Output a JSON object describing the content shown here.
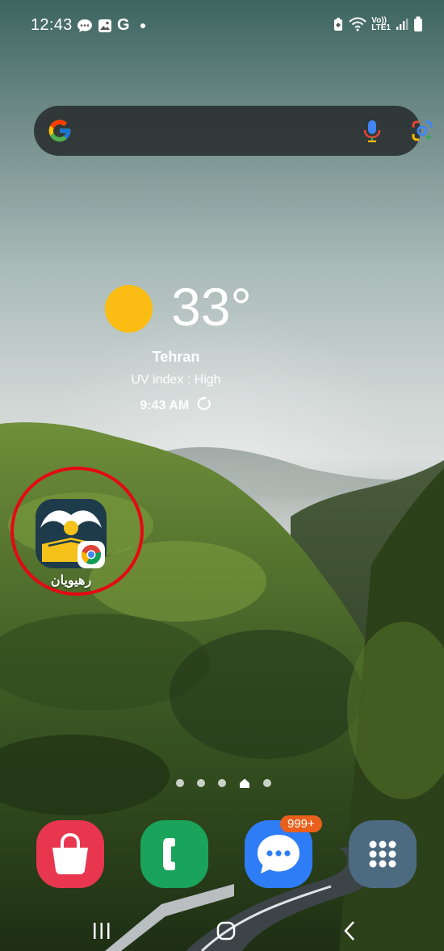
{
  "status_bar": {
    "time": "12:43",
    "notification_icons": [
      "message-icon",
      "gallery-icon",
      "google-icon",
      "dot-icon"
    ],
    "right_icons": [
      "battery-saver-icon",
      "wifi-icon",
      "volte-lte-icon",
      "signal-icon",
      "battery-icon"
    ],
    "volte_text": "Vo))",
    "lte_text": "LTE1"
  },
  "search_bar": {
    "icons": [
      "google-g-icon",
      "microphone-icon",
      "google-lens-icon"
    ]
  },
  "weather": {
    "temperature": "33°",
    "city": "Tehran",
    "uv": "UV index : High",
    "time": "9:43 AM"
  },
  "desktop_app": {
    "label": "رهیویان",
    "overlay_icon": "chrome-icon"
  },
  "page_indicator": {
    "pages": 5,
    "current": 4,
    "home_page": 4
  },
  "dock": {
    "apps": [
      {
        "name": "Galaxy Store",
        "icon": "shopping-bag-icon",
        "color": "#e8364f"
      },
      {
        "name": "Phone",
        "icon": "phone-icon",
        "color": "#1aa35a"
      },
      {
        "name": "Messages",
        "icon": "chat-bubble-icon",
        "color": "#2f7df6"
      },
      {
        "name": "Apps",
        "icon": "app-grid-icon",
        "color": "#4c6a80"
      }
    ],
    "messages_badge": "999+"
  },
  "nav_bar": {
    "buttons": [
      "recents-icon",
      "home-icon",
      "back-icon"
    ]
  },
  "colors": {
    "sun": "#fbbd13",
    "highlight_circle": "#e50812",
    "badge": "#e8601c"
  }
}
